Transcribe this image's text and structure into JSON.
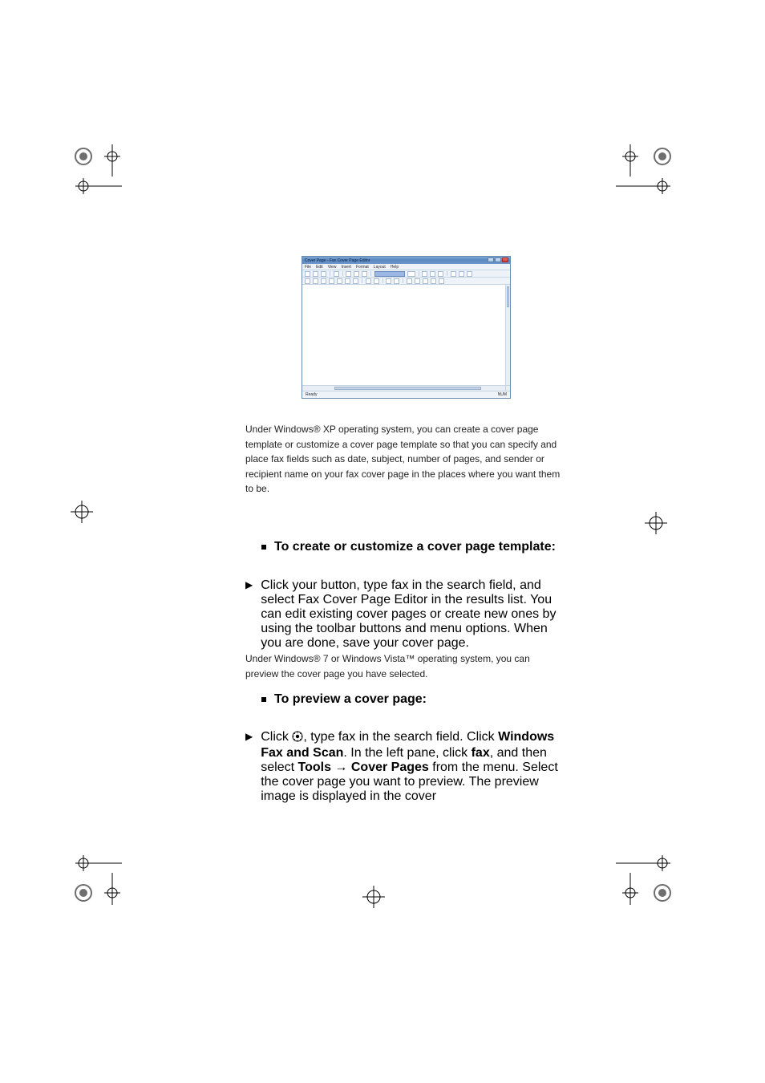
{
  "figure": {
    "window_title": "Cover Page - Fax Cover Page Editor",
    "menus": [
      "File",
      "Edit",
      "View",
      "Insert",
      "Format",
      "Layout",
      "Help"
    ],
    "status_left": "Ready",
    "status_right": "NUM"
  },
  "para1": "Under Windows® XP operating system, you can create a cover page template or customize a cover page template so that you can specify and place fax fields such as date, subject, number of pages, and sender or recipient name on your fax cover page in the places where you want them to be.",
  "section1": {
    "heading": "To create or customize a cover page template:",
    "step": "Click your button, type fax in the search field, and select Fax Cover Page Editor in the results list. You can edit existing cover pages or create new ones by using the toolbar buttons and menu options. When you are done, save your cover page."
  },
  "para2": "Under Windows® 7 or Windows Vista™ operating system, you can preview the cover page you have selected.",
  "section2": {
    "heading": "To preview a cover page:",
    "step_prefix": "Click ",
    "step_mid": ", type fax in the search field. Click ",
    "step_app": "Windows Fax and Scan",
    "step_cont1": ". In the left pane, click ",
    "step_fax": "fax",
    "step_cont2": ", and then select ",
    "step_tools": "Tools",
    "step_arrow": " → ",
    "step_cp": "Cover Pages",
    "step_cont3": " from the menu. Select the cover page you want to preview. The preview image is displayed in the cover"
  },
  "reg_colors": {
    "ring": "#707070",
    "inner": "#8a8a8a"
  }
}
